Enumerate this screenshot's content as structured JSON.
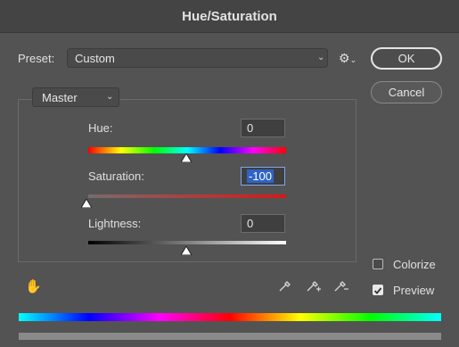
{
  "title": "Hue/Saturation",
  "preset": {
    "label": "Preset:",
    "value": "Custom"
  },
  "buttons": {
    "ok": "OK",
    "cancel": "Cancel"
  },
  "channel": {
    "value": "Master"
  },
  "sliders": {
    "hue": {
      "label": "Hue:",
      "value": "0"
    },
    "saturation": {
      "label": "Saturation:",
      "value": "-100"
    },
    "lightness": {
      "label": "Lightness:",
      "value": "0"
    }
  },
  "options": {
    "colorize": {
      "label": "Colorize",
      "checked": false
    },
    "preview": {
      "label": "Preview",
      "checked": true
    }
  },
  "icons": {
    "settings": "gear-icon",
    "target_adjust": "hand-adjust-icon",
    "eyedropper": "eyedropper-icon",
    "eyedropper_add": "eyedropper-plus-icon",
    "eyedropper_subtract": "eyedropper-minus-icon"
  },
  "colors": {
    "background": "#535353",
    "titlebar": "#444444",
    "selection": "#2e64c8"
  }
}
